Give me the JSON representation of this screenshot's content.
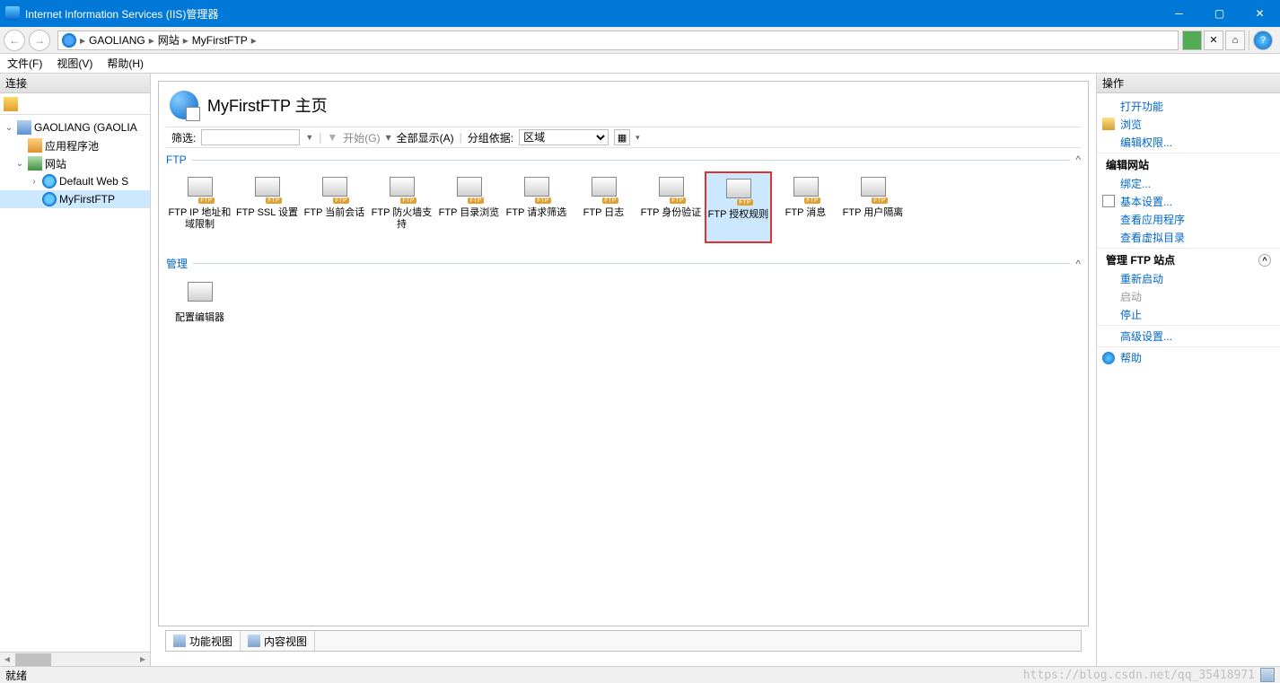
{
  "window": {
    "title": "Internet Information Services (IIS)管理器"
  },
  "breadcrumb": {
    "parts": [
      "GAOLIANG",
      "网站",
      "MyFirstFTP"
    ]
  },
  "menu": {
    "file": "文件(F)",
    "view": "视图(V)",
    "help": "帮助(H)"
  },
  "left": {
    "header": "连接",
    "nodes": {
      "root": "GAOLIANG (GAOLIA",
      "pool": "应用程序池",
      "sites": "网站",
      "default": "Default Web S",
      "ftp": "MyFirstFTP"
    }
  },
  "center": {
    "title": "MyFirstFTP 主页",
    "filter_label": "筛选:",
    "start": "开始(G)",
    "showall": "全部显示(A)",
    "groupby_label": "分组依据:",
    "groupby_value": "区域",
    "groups": {
      "ftp": "FTP",
      "mgmt": "管理"
    },
    "features_ftp": [
      "FTP IP 地址和域限制",
      "FTP SSL 设置",
      "FTP 当前会话",
      "FTP 防火墙支持",
      "FTP 目录浏览",
      "FTP 请求筛选",
      "FTP 日志",
      "FTP 身份验证",
      "FTP 授权规则",
      "FTP 消息",
      "FTP 用户隔离"
    ],
    "features_mgmt": [
      "配置编辑器"
    ],
    "tabs": {
      "features": "功能视图",
      "content": "内容视图"
    }
  },
  "right": {
    "header": "操作",
    "open_feature": "打开功能",
    "browse": "浏览",
    "edit_perm": "编辑权限...",
    "edit_site_header": "编辑网站",
    "bindings": "绑定...",
    "basic": "基本设置...",
    "view_apps": "查看应用程序",
    "view_vdirs": "查看虚拟目录",
    "manage_ftp_header": "管理 FTP 站点",
    "restart": "重新启动",
    "start": "启动",
    "stop": "停止",
    "advanced": "高级设置...",
    "help": "帮助"
  },
  "status": {
    "ready": "就绪",
    "watermark": "https://blog.csdn.net/qq_35418971"
  }
}
